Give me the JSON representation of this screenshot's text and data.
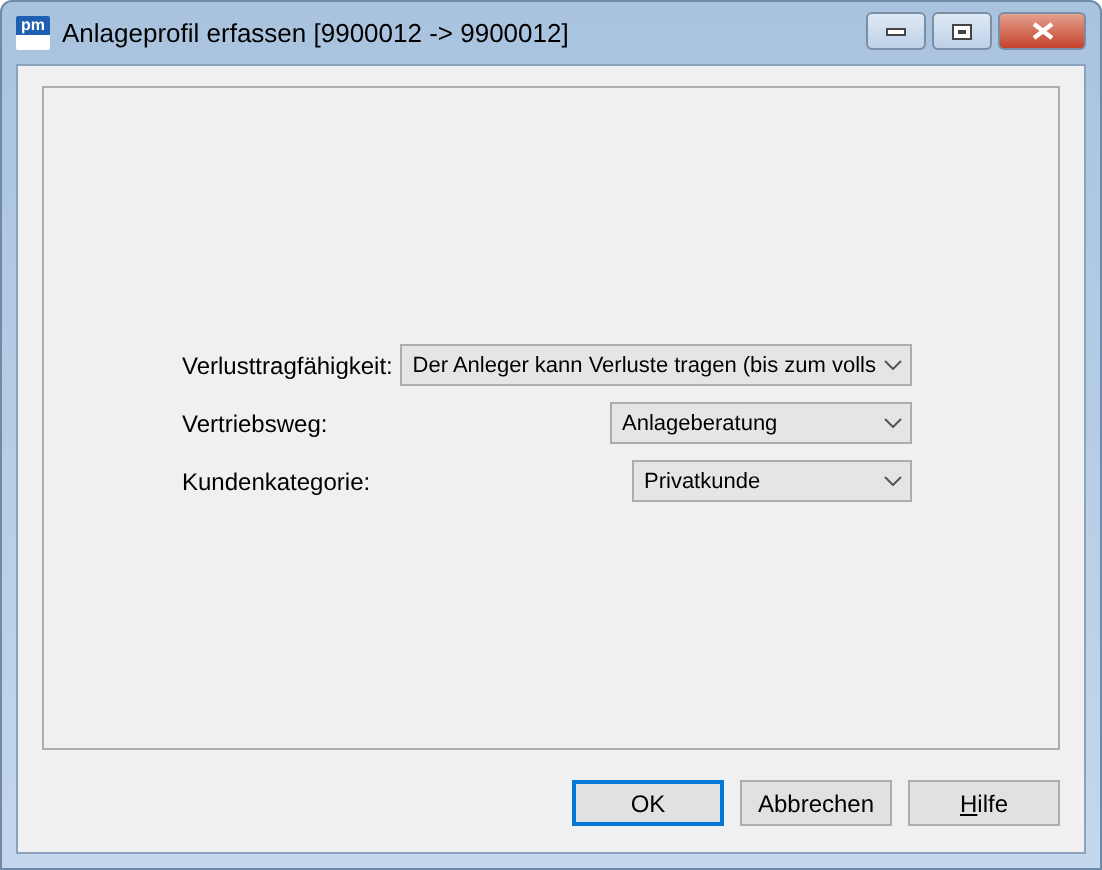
{
  "window": {
    "title": "Anlageprofil erfassen [9900012 -> 9900012]",
    "app_icon": "pm"
  },
  "fields": [
    {
      "label": "Verlusttragfähigkeit:",
      "value": "Der Anleger kann Verluste tragen (bis zum volls"
    },
    {
      "label": "Vertriebsweg:",
      "value": "Anlageberatung"
    },
    {
      "label": "Kundenkategorie:",
      "value": "Privatkunde"
    }
  ],
  "buttons": [
    {
      "label": "OK",
      "focused": true,
      "mnemonic": false
    },
    {
      "label": "Abbrechen",
      "focused": false,
      "mnemonic": false
    },
    {
      "label": "Hilfe",
      "focused": false,
      "mnemonic": true
    }
  ]
}
